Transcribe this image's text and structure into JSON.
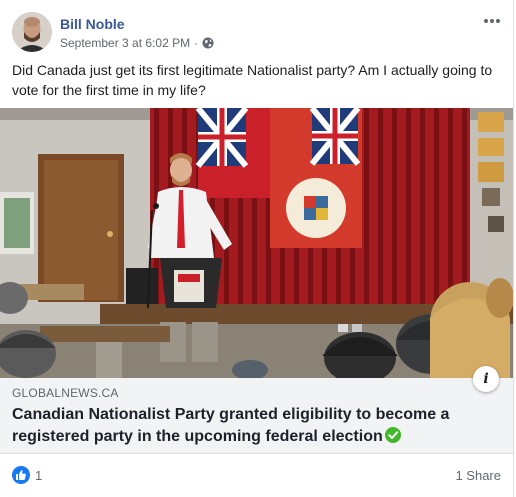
{
  "post": {
    "author": "Bill Noble",
    "timestamp": "September 3 at 6:02 PM",
    "separator": "·",
    "privacy_icon": "globe-icon",
    "more_icon": "more-horizontal-icon",
    "text": "Did Canada just get its first legitimate Nationalist party? Am I actually going to vote for the first time in my life?"
  },
  "link": {
    "domain": "GLOBALNEWS.CA",
    "headline": "Canadian Nationalist Party granted eligibility to become a registered party in the upcoming federal election",
    "verified_icon": "verified-check-icon",
    "info_label": "i"
  },
  "footer": {
    "reaction_icon": "like-thumb-icon",
    "reaction_count": "1",
    "share_count": "1 Share"
  },
  "colors": {
    "author_link": "#385898",
    "like_blue": "#1877f2",
    "verified_green": "#42b72a",
    "link_bg": "#f2f3f5"
  }
}
